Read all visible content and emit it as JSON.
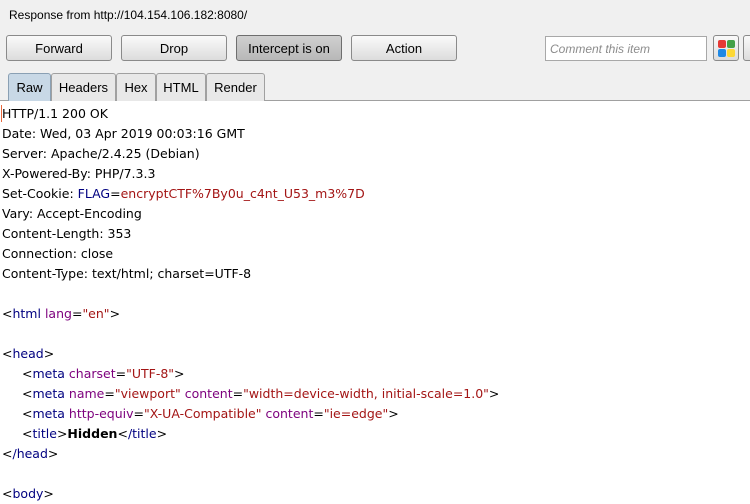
{
  "window": {
    "title": "Response from http://104.154.106.182:8080/"
  },
  "toolbar": {
    "forward_label": "Forward",
    "drop_label": "Drop",
    "intercept_label": "Intercept is on",
    "action_label": "Action",
    "comment_placeholder": "Comment this item",
    "highlight_colors": [
      "#e53935",
      "#43a047",
      "#1e88e5",
      "#fdd835"
    ]
  },
  "tabs": [
    "Raw",
    "Headers",
    "Hex",
    "HTML",
    "Render"
  ],
  "response": {
    "status_line": "HTTP/1.1 200 OK",
    "headers": {
      "date": "Date: Wed, 03 Apr 2019 00:03:16 GMT",
      "server": "Server: Apache/2.4.25 (Debian)",
      "powered_by": "X-Powered-By: PHP/7.3.3",
      "set_cookie_name": "Set-Cookie: ",
      "cookie_key": "FLAG",
      "cookie_eq": "=",
      "cookie_value": "encryptCTF%7By0u_c4nt_U53_m3%7D",
      "vary": "Vary: Accept-Encoding",
      "content_length": "Content-Length: 353",
      "connection": "Connection: close",
      "content_type": "Content-Type: text/html; charset=UTF-8"
    },
    "html": {
      "lt": "<",
      "gt": ">",
      "html_tag": "html",
      "lang_attr": "lang",
      "lang_val": "\"en\"",
      "head_tag": "head",
      "meta_tag": "meta",
      "charset_attr": "charset",
      "charset_val": "\"UTF-8\"",
      "name_attr": "name",
      "name_val": "\"viewport\"",
      "content_attr": "content",
      "viewport_content": "\"width=device-width, initial-scale=1.0\"",
      "http_equiv_attr": "http-equiv",
      "http_equiv_val": "\"X-UA-Compatible\"",
      "ie_content": "\"ie=edge\"",
      "title_tag": "title",
      "title_text": "Hidden",
      "head_close": "/head",
      "title_close": "/title",
      "body_tag": "body",
      "eq": "="
    }
  }
}
